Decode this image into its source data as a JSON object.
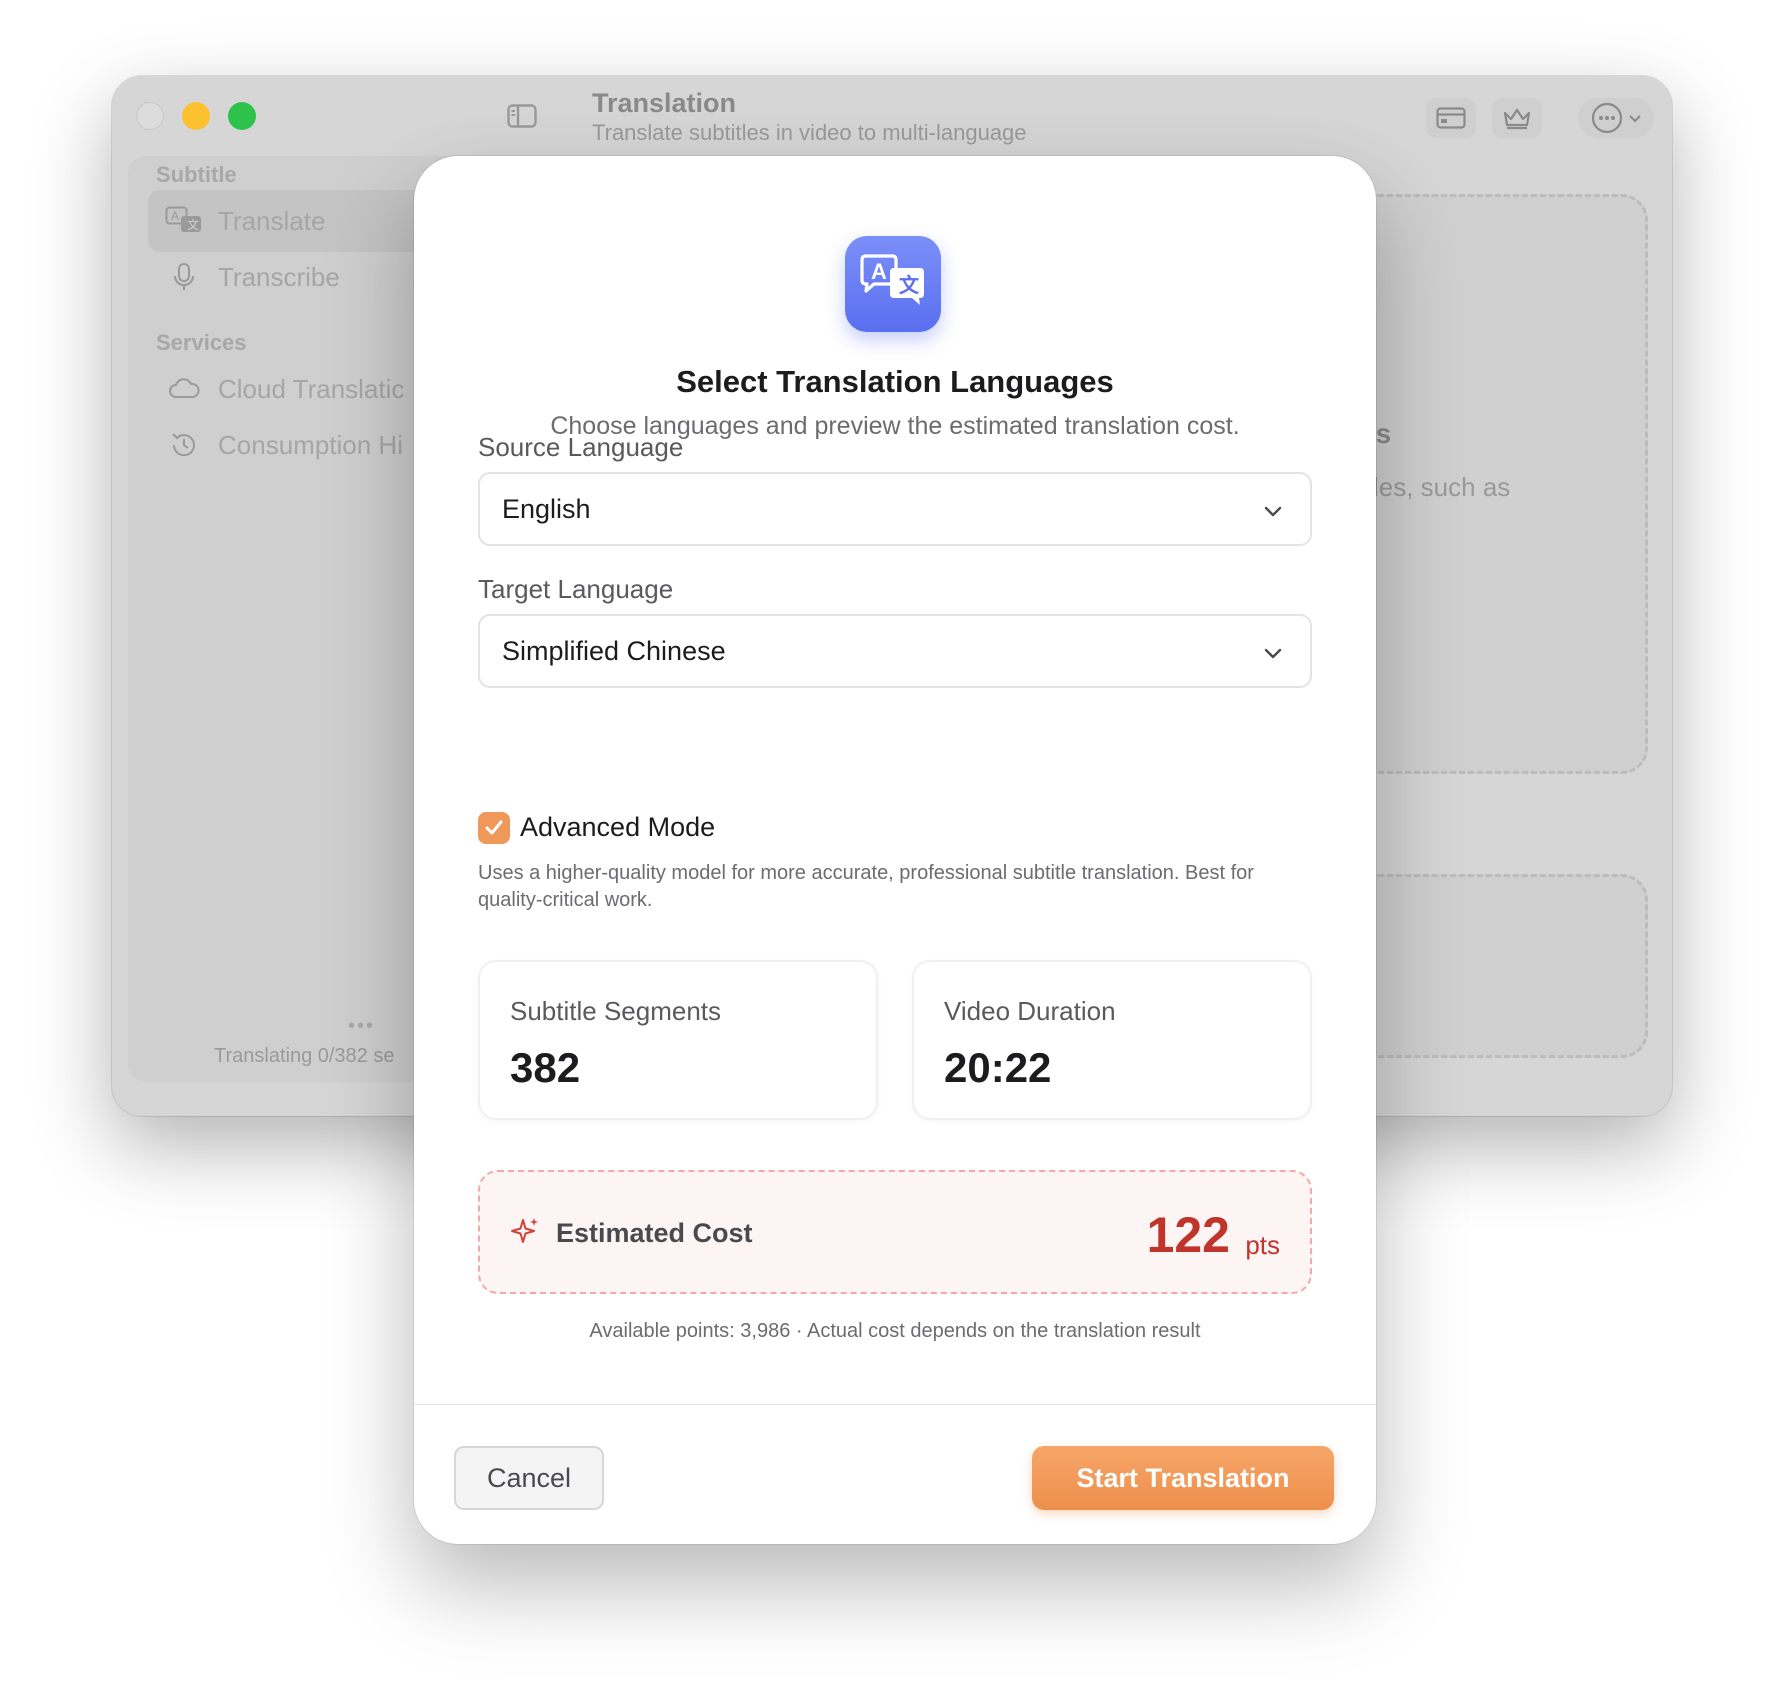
{
  "app": {
    "title": "Translation",
    "subtitle": "Translate subtitles in video to multi-language"
  },
  "sidebar": {
    "sections": [
      {
        "label": "Subtitle",
        "items": [
          {
            "label": "Translate",
            "icon": "translate-icon",
            "active": true
          },
          {
            "label": "Transcribe",
            "icon": "microphone-icon",
            "active": false
          }
        ]
      },
      {
        "label": "Services",
        "items": [
          {
            "label": "Cloud Translatic",
            "icon": "cloud-icon",
            "active": false
          },
          {
            "label": "Consumption Hi",
            "icon": "history-icon",
            "active": false
          }
        ]
      }
    ],
    "status": "Translating 0/382 se"
  },
  "background": {
    "heading_fragment": "es",
    "text_fragment": "itles, such as"
  },
  "modal": {
    "icon": "translate-icon",
    "title": "Select Translation Languages",
    "subtitle": "Choose languages and preview the estimated translation cost.",
    "source_label": "Source Language",
    "source_value": "English",
    "target_label": "Target Language",
    "target_value": "Simplified Chinese",
    "advanced_mode": {
      "label": "Advanced Mode",
      "checked": true,
      "description": "Uses a higher-quality model for more accurate, professional subtitle translation. Best for quality-critical work."
    },
    "stats": [
      {
        "label": "Subtitle Segments",
        "value": "382"
      },
      {
        "label": "Video Duration",
        "value": "20:22"
      }
    ],
    "cost": {
      "label": "Estimated Cost",
      "value": "122",
      "unit": "pts",
      "note": "Available points: 3,986 · Actual cost depends on the translation result"
    },
    "cancel_label": "Cancel",
    "start_label": "Start Translation"
  },
  "colors": {
    "accent_orange": "#ee8f4c",
    "cost_red": "#c0342c",
    "icon_blue": "#5a6ff0"
  }
}
